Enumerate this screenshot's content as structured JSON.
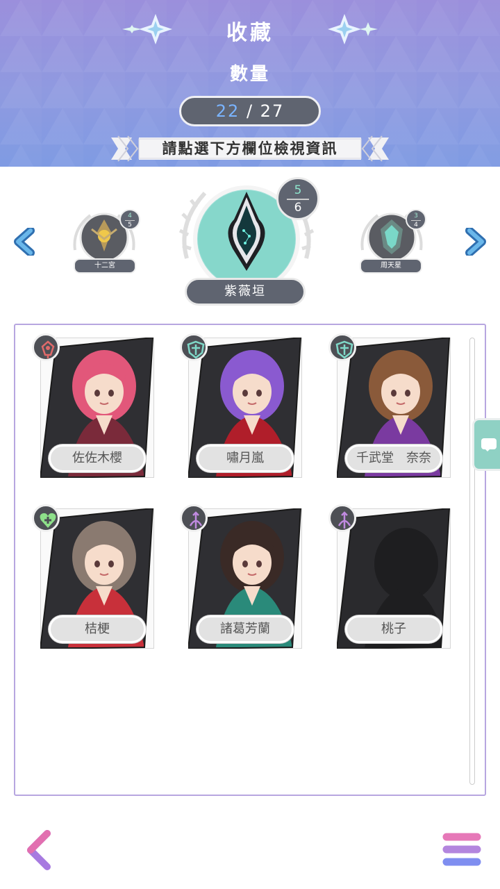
{
  "header": {
    "title": "收藏",
    "count_label": "數量",
    "count_current": "22",
    "count_separator": " / ",
    "count_total": "27",
    "instruction": "請點選下方欄位檢視資訊"
  },
  "collection_selector": {
    "current": {
      "name": "紫薇垣",
      "owned": "5",
      "total": "6"
    },
    "previous": {
      "name": "十二宮",
      "owned": "4",
      "total": "5"
    },
    "next": {
      "name": "周天星",
      "owned": "3",
      "total": "4"
    }
  },
  "cards": [
    {
      "name": "佐佐木櫻",
      "class_icon": "mage-icon",
      "class_color": "#e06a6a",
      "hair_color": "#e2577a",
      "outfit_color": "#7a2a3a",
      "unlocked": true
    },
    {
      "name": "嘯月嵐",
      "class_icon": "shield-icon",
      "class_color": "#7fd8c8",
      "hair_color": "#8a5ad0",
      "outfit_color": "#b01e2a",
      "unlocked": true
    },
    {
      "name": "千武堂　奈奈",
      "class_icon": "shield-icon",
      "class_color": "#7fd8c8",
      "hair_color": "#8a5a3a",
      "outfit_color": "#7a3aa0",
      "unlocked": true
    },
    {
      "name": "桔梗",
      "class_icon": "heal-heart-icon",
      "class_color": "#8ee08a",
      "hair_color": "#8a7a70",
      "outfit_color": "#c8303a",
      "unlocked": true
    },
    {
      "name": "諸葛芳蘭",
      "class_icon": "archer-icon",
      "class_color": "#c08ae0",
      "hair_color": "#3a2a26",
      "outfit_color": "#2a8a7a",
      "unlocked": true
    },
    {
      "name": "桃子",
      "class_icon": "archer-icon",
      "class_color": "#c08ae0",
      "hair_color": "#1a1a1a",
      "outfit_color": "#1a1a1a",
      "unlocked": false
    }
  ],
  "colors": {
    "header_top": "#9b8fdc",
    "header_bottom": "#7f9be3",
    "panel_border": "#b7a6e0",
    "accent_blue": "#7ab4ff",
    "teal": "#8fd1c4"
  },
  "icons": {
    "back": "chevron-left-icon",
    "menu": "hamburger-menu-icon",
    "chat": "chat-bubble-icon"
  }
}
